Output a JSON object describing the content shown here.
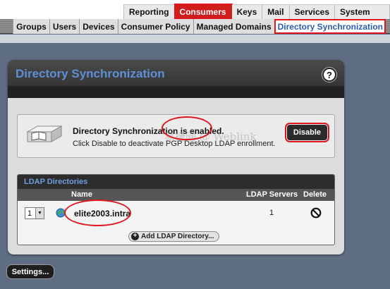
{
  "top_nav": {
    "tabs": [
      "Reporting",
      "Consumers",
      "Keys",
      "Mail",
      "Services",
      "System"
    ],
    "active": "Consumers"
  },
  "sub_nav": {
    "tabs": [
      "Groups",
      "Users",
      "Devices",
      "Consumer Policy",
      "Managed Domains",
      "Directory Synchronization"
    ],
    "active": "Directory Synchronization"
  },
  "panel": {
    "title": "Directory Synchronization",
    "help_label": "?"
  },
  "status": {
    "title": "Directory Synchronization is enabled.",
    "subtitle": "Click Disable to deactivate PGP Desktop LDAP enrollment.",
    "disable_label": "Disable",
    "watermark": "易捷网 @ Weblink"
  },
  "ldap": {
    "section_title": "LDAP Directories",
    "columns": {
      "name": "Name",
      "servers": "LDAP Servers",
      "delete": "Delete"
    },
    "rows": [
      {
        "order": "1",
        "name": "elite2003.intra",
        "servers": "1"
      }
    ],
    "add_label": "Add LDAP Directory..."
  },
  "settings_label": "Settings...",
  "colors": {
    "accent_red": "#e0141e",
    "title_blue": "#5f8fd6",
    "background": "#5f6d83"
  }
}
